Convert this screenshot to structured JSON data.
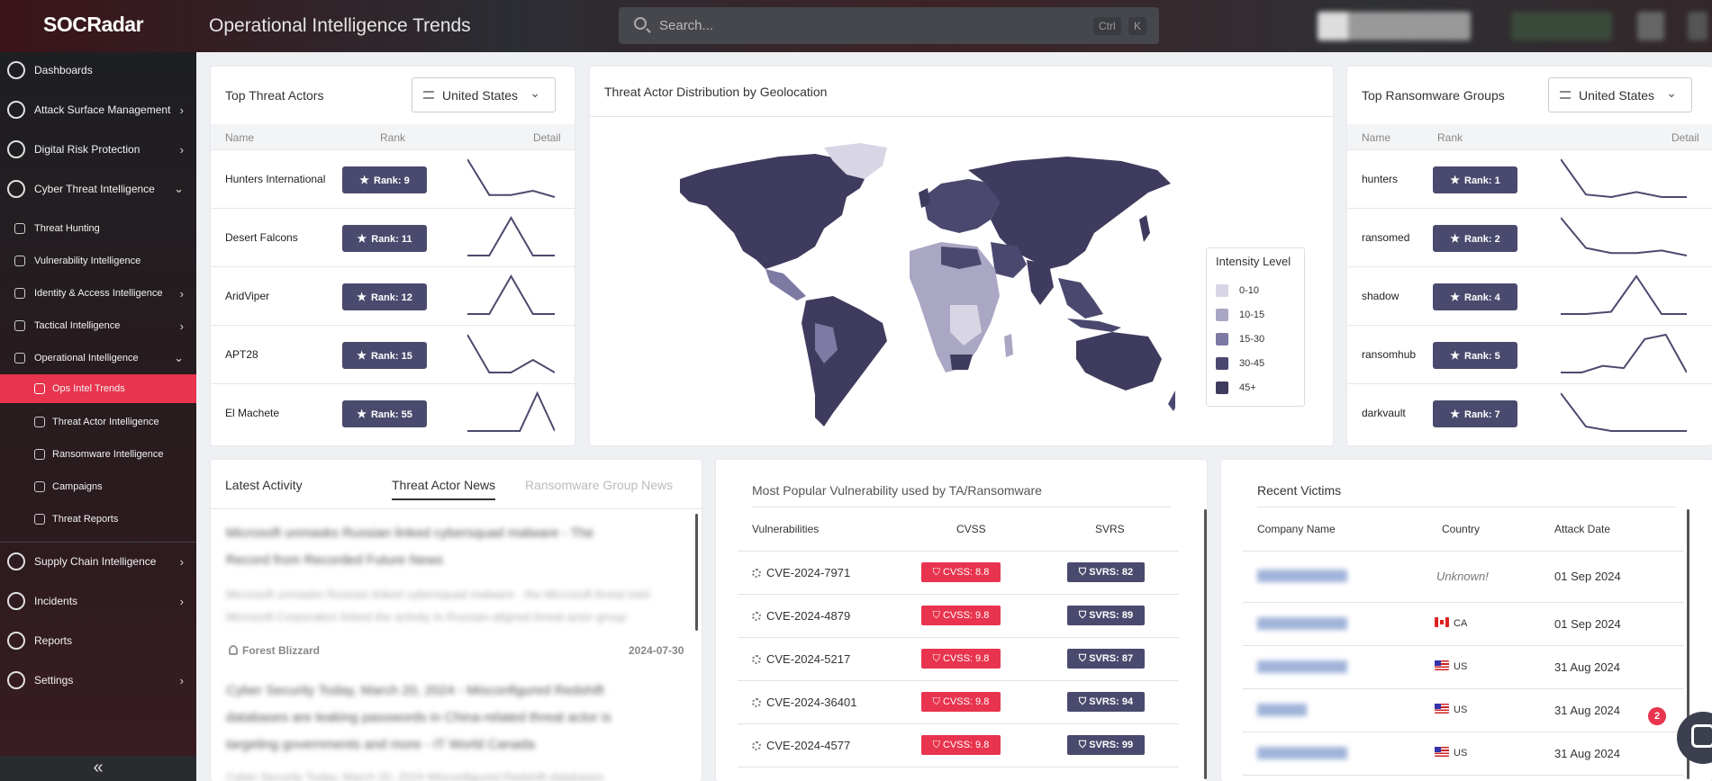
{
  "app": {
    "logo": "SOCRadar",
    "page_title": "Operational Intelligence Trends"
  },
  "search": {
    "placeholder": "Search...",
    "kbd1": "Ctrl",
    "kbd2": "K"
  },
  "sidebar": {
    "items": [
      {
        "label": "Dashboards",
        "icon": "dashboard-icon"
      },
      {
        "label": "Attack Surface Management",
        "icon": "asm-icon"
      },
      {
        "label": "Digital Risk Protection",
        "icon": "hand-icon"
      },
      {
        "label": "Cyber Threat Intelligence",
        "icon": "fingerprint-icon"
      },
      {
        "label": "Threat Hunting",
        "icon": "search-icon"
      },
      {
        "label": "Vulnerability Intelligence",
        "icon": "bug-icon"
      },
      {
        "label": "Identity & Access Intelligence",
        "icon": "identity-icon"
      },
      {
        "label": "Tactical Intelligence",
        "icon": "tactical-icon"
      },
      {
        "label": "Operational Intelligence",
        "icon": "gear-icon"
      },
      {
        "label": "Ops Intel Trends",
        "icon": "trends-icon"
      },
      {
        "label": "Threat Actor Intelligence",
        "icon": "actor-icon"
      },
      {
        "label": "Ransomware Intelligence",
        "icon": "virus-icon"
      },
      {
        "label": "Campaigns",
        "icon": "flame-icon"
      },
      {
        "label": "Threat Reports",
        "icon": "report-icon"
      },
      {
        "label": "Supply Chain Intelligence",
        "icon": "supply-icon"
      },
      {
        "label": "Incidents",
        "icon": "warning-icon"
      },
      {
        "label": "Reports",
        "icon": "reports-icon"
      },
      {
        "label": "Settings",
        "icon": "settings-icon"
      }
    ],
    "collapse": "«"
  },
  "top_actors": {
    "title": "Top Threat Actors",
    "filter": "United States",
    "headers": {
      "name": "Name",
      "rank": "Rank",
      "detail": "Detail"
    },
    "rows": [
      {
        "name": "Hunters International",
        "rank": "Rank: 9",
        "trend": [
          20,
          3,
          3,
          5,
          2
        ]
      },
      {
        "name": "Desert Falcons",
        "rank": "Rank: 11",
        "trend": [
          3,
          3,
          20,
          3,
          3
        ]
      },
      {
        "name": "AridViper",
        "rank": "Rank: 12",
        "trend": [
          4,
          4,
          20,
          4,
          4
        ]
      },
      {
        "name": "APT28",
        "rank": "Rank: 15",
        "trend": [
          20,
          5,
          5,
          10,
          5
        ]
      },
      {
        "name": "El Machete",
        "rank": "Rank: 55",
        "trend": [
          3,
          3,
          3,
          3,
          20,
          3
        ]
      }
    ]
  },
  "geo": {
    "title": "Threat Actor Distribution by Geolocation",
    "legend_title": "Intensity Level",
    "legend": [
      {
        "label": "0-10",
        "color": "#d8d6e4"
      },
      {
        "label": "10-15",
        "color": "#aaa7c4"
      },
      {
        "label": "15-30",
        "color": "#7d7aa3"
      },
      {
        "label": "30-45",
        "color": "#4b4870"
      },
      {
        "label": "45+",
        "color": "#3e3b5e"
      }
    ]
  },
  "top_ransom": {
    "title": "Top Ransomware Groups",
    "filter": "United States",
    "headers": {
      "name": "Name",
      "rank": "Rank",
      "detail": "Detail"
    },
    "rows": [
      {
        "name": "hunters",
        "rank": "Rank: 1",
        "trend": [
          20,
          6,
          5,
          7,
          5,
          5
        ]
      },
      {
        "name": "ransomed",
        "rank": "Rank: 2",
        "trend": [
          20,
          8,
          6,
          6,
          7,
          5
        ]
      },
      {
        "name": "shadow",
        "rank": "Rank: 4",
        "trend": [
          3,
          3,
          4,
          20,
          3,
          3
        ]
      },
      {
        "name": "ransomhub",
        "rank": "Rank: 5",
        "trend": [
          3,
          3,
          6,
          5,
          18,
          20,
          3
        ]
      },
      {
        "name": "darkvault",
        "rank": "Rank: 7",
        "trend": [
          20,
          5,
          3,
          3,
          3,
          3
        ]
      }
    ]
  },
  "activity": {
    "title": "Latest Activity",
    "tab1": "Threat Actor News",
    "tab2": "Ransomware Group News",
    "items": [
      {
        "author": "Forest Blizzard",
        "date": "2024-07-30"
      }
    ]
  },
  "vulns": {
    "title": "Most Popular Vulnerability used by TA/Ransomware",
    "headers": {
      "v": "Vulnerabilities",
      "cvss": "CVSS",
      "svrs": "SVRS"
    },
    "rows": [
      {
        "id": "CVE-2024-7971",
        "cvss": "CVSS: 8.8",
        "svrs": "SVRS: 82"
      },
      {
        "id": "CVE-2024-4879",
        "cvss": "CVSS: 9.8",
        "svrs": "SVRS: 89"
      },
      {
        "id": "CVE-2024-5217",
        "cvss": "CVSS: 9.8",
        "svrs": "SVRS: 87"
      },
      {
        "id": "CVE-2024-36401",
        "cvss": "CVSS: 9.8",
        "svrs": "SVRS: 94"
      },
      {
        "id": "CVE-2024-4577",
        "cvss": "CVSS: 9.8",
        "svrs": "SVRS: 99"
      }
    ]
  },
  "victims": {
    "title": "Recent Victims",
    "headers": {
      "company": "Company Name",
      "country": "Country",
      "date": "Attack Date"
    },
    "rows": [
      {
        "country": "Unknown!",
        "flag": "",
        "date": "01 Sep 2024"
      },
      {
        "country": "CA",
        "flag": "ca",
        "date": "01 Sep 2024"
      },
      {
        "country": "US",
        "flag": "us",
        "date": "31 Aug 2024"
      },
      {
        "country": "US",
        "flag": "us",
        "date": "31 Aug 2024"
      },
      {
        "country": "US",
        "flag": "us",
        "date": "31 Aug 2024"
      }
    ]
  },
  "chat": {
    "badge": "2"
  }
}
